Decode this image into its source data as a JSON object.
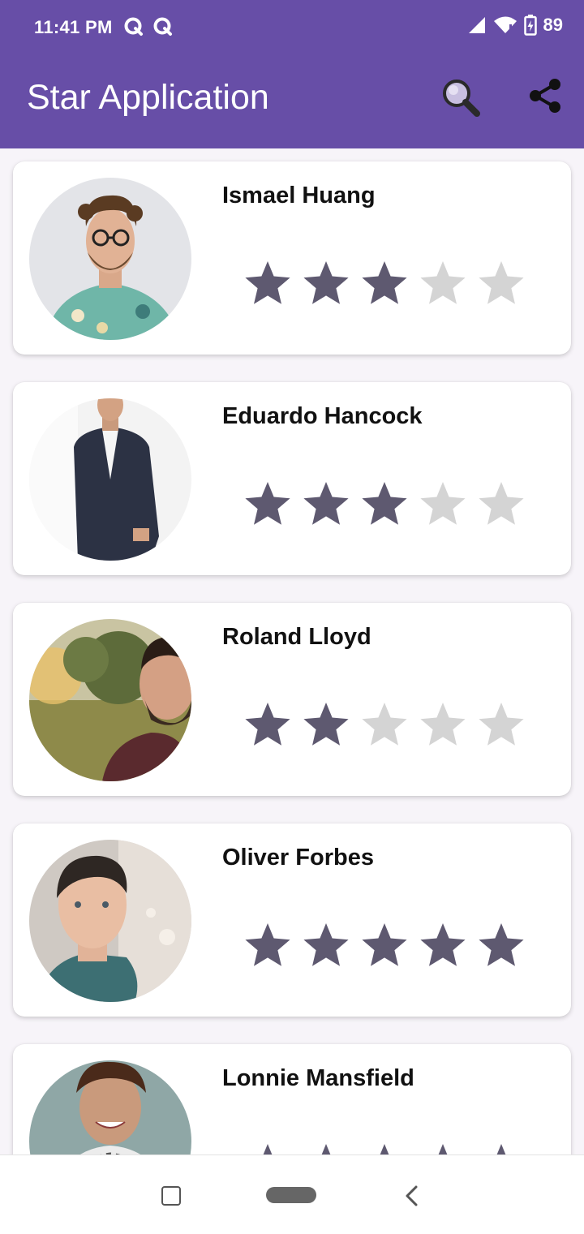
{
  "status_bar": {
    "time": "11:41 PM",
    "battery": "89",
    "icons": [
      "q-app-icon",
      "q-app-icon",
      "signal-icon",
      "wifi-icon",
      "battery-charging-icon"
    ]
  },
  "app_bar": {
    "title": "Star Application",
    "search_icon": "search-icon",
    "share_icon": "share-icon"
  },
  "colors": {
    "primary": "#674ea7",
    "star_filled": "#5e5970",
    "star_empty": "#d4d4d4"
  },
  "rating_max": 5,
  "people": [
    {
      "name": "Ismael Huang",
      "rating": 3
    },
    {
      "name": "Eduardo Hancock",
      "rating": 3
    },
    {
      "name": "Roland Lloyd",
      "rating": 2
    },
    {
      "name": "Oliver Forbes",
      "rating": 5
    },
    {
      "name": "Lonnie Mansfield",
      "rating": 5
    }
  ],
  "nav_bar": {
    "items": [
      "recent-apps-button",
      "home-button",
      "back-button"
    ]
  }
}
